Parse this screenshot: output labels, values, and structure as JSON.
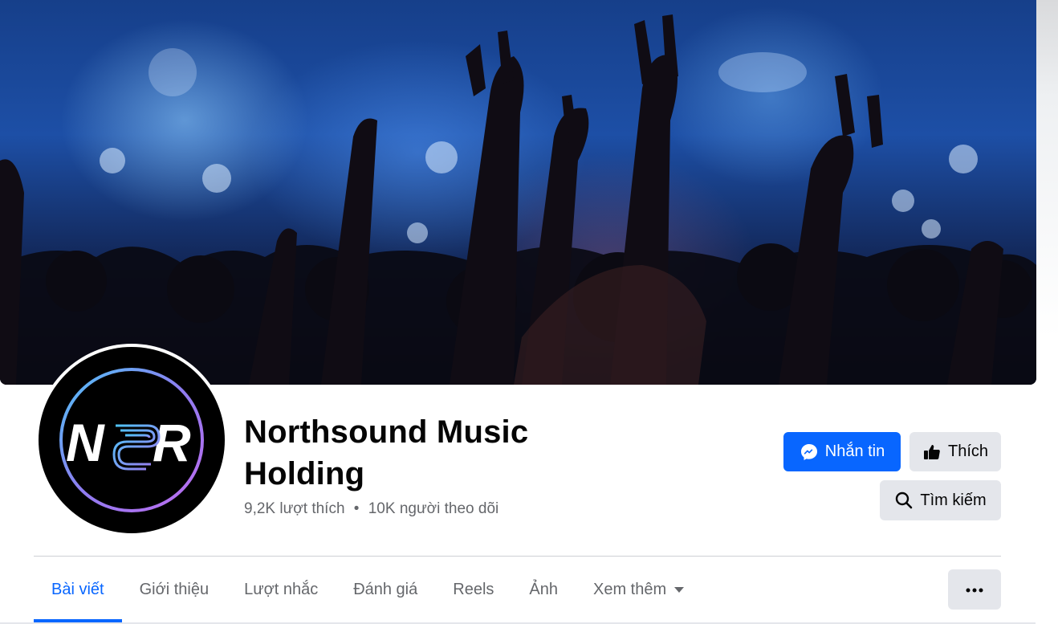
{
  "page": {
    "name": "Northsound Music Holding",
    "likes": "9,2K lượt thích",
    "separator": "•",
    "followers": "10K người theo dõi"
  },
  "avatar": {
    "logo_text": "NSR"
  },
  "actions": {
    "message_label": "Nhắn tin",
    "like_label": "Thích",
    "search_label": "Tìm kiếm"
  },
  "tabs": [
    {
      "label": "Bài viết",
      "active": true
    },
    {
      "label": "Giới thiệu"
    },
    {
      "label": "Lượt nhắc"
    },
    {
      "label": "Đánh giá"
    },
    {
      "label": "Reels"
    },
    {
      "label": "Ảnh"
    },
    {
      "label": "Xem thêm"
    }
  ],
  "icons": {
    "message": "messenger-icon",
    "like": "thumbs-up-icon",
    "search": "search-icon",
    "more": "more-horizontal-icon",
    "dropdown": "caret-down-icon"
  },
  "colors": {
    "accent": "#0866ff",
    "secondary_button": "#e4e6eb",
    "text_primary": "#050505",
    "text_secondary": "#65676b"
  }
}
